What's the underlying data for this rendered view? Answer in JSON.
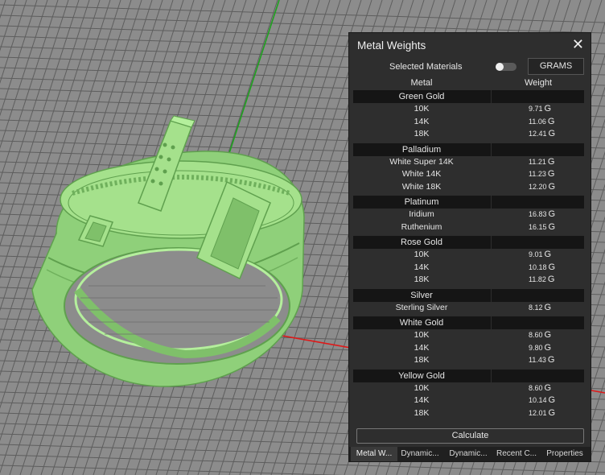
{
  "panel": {
    "title": "Metal Weights",
    "close_glyph": "✕",
    "selected_materials_label": "Selected Materials",
    "units_button": "GRAMS",
    "toggle_on": false,
    "columns": {
      "metal": "Metal",
      "weight": "Weight"
    },
    "calculate_label": "Calculate"
  },
  "groups": [
    {
      "name": "Green Gold",
      "rows": [
        {
          "name": "10K",
          "value": "9.71",
          "unit": "G"
        },
        {
          "name": "14K",
          "value": "11.06",
          "unit": "G"
        },
        {
          "name": "18K",
          "value": "12.41",
          "unit": "G"
        }
      ]
    },
    {
      "name": "Palladium",
      "rows": [
        {
          "name": "White Super 14K",
          "value": "11.21",
          "unit": "G"
        },
        {
          "name": "White 14K",
          "value": "11.23",
          "unit": "G"
        },
        {
          "name": "White 18K",
          "value": "12.20",
          "unit": "G"
        }
      ]
    },
    {
      "name": "Platinum",
      "rows": [
        {
          "name": "Iridium",
          "value": "16.83",
          "unit": "G"
        },
        {
          "name": "Ruthenium",
          "value": "16.15",
          "unit": "G"
        }
      ]
    },
    {
      "name": "Rose Gold",
      "rows": [
        {
          "name": "10K",
          "value": "9.01",
          "unit": "G"
        },
        {
          "name": "14K",
          "value": "10.18",
          "unit": "G"
        },
        {
          "name": "18K",
          "value": "11.82",
          "unit": "G"
        }
      ]
    },
    {
      "name": "Silver",
      "rows": [
        {
          "name": "Sterling Silver",
          "value": "8.12",
          "unit": "G"
        }
      ]
    },
    {
      "name": "White Gold",
      "rows": [
        {
          "name": "10K",
          "value": "8.60",
          "unit": "G"
        },
        {
          "name": "14K",
          "value": "9.80",
          "unit": "G"
        },
        {
          "name": "18K",
          "value": "11.43",
          "unit": "G"
        }
      ]
    },
    {
      "name": "Yellow Gold",
      "rows": [
        {
          "name": "10K",
          "value": "8.60",
          "unit": "G"
        },
        {
          "name": "14K",
          "value": "10.14",
          "unit": "G"
        },
        {
          "name": "18K",
          "value": "12.01",
          "unit": "G"
        }
      ]
    }
  ],
  "tabs": [
    {
      "label": "Metal W...",
      "active": true
    },
    {
      "label": "Dynamic...",
      "active": false
    },
    {
      "label": "Dynamic...",
      "active": false
    },
    {
      "label": "Recent C...",
      "active": false
    },
    {
      "label": "Properties",
      "active": false
    }
  ],
  "colors": {
    "viewport_bg": "#8c8c8c",
    "grid_line": "#5e5e5e",
    "axis_green": "#1fa01f",
    "axis_red": "#e01818",
    "model_fill": "#8fd07a",
    "model_highlight": "#b4ef9c",
    "model_shadow": "#5fa04e",
    "panel_bg": "#2e2e2e",
    "group_bg": "#151515"
  }
}
